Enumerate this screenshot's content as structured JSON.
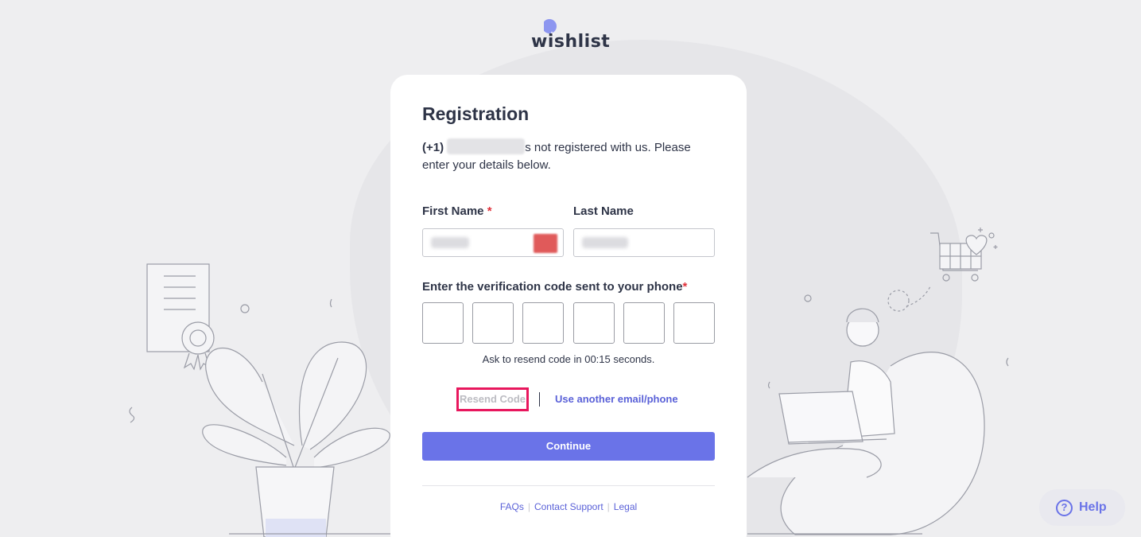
{
  "brand": {
    "name": "wishlist",
    "accent_color": "#6a73e8",
    "logo_icon": "balloon-star-icon"
  },
  "registration": {
    "title": "Registration",
    "country_code": "(+1)",
    "message": "s not registered with us. Please enter your details below.",
    "first_name_label": "First Name",
    "first_name_required": "*",
    "last_name_label": "Last Name",
    "verification_label": "Enter the verification code sent to your phone",
    "verification_required": "*",
    "code_digits": [
      "",
      "",
      "",
      "",
      "",
      ""
    ],
    "timer_text": "Ask to resend code in 00:15 seconds.",
    "resend_label": "Resend Code",
    "alt_link_label": "Use another email/phone",
    "continue_label": "Continue"
  },
  "footer": {
    "links": [
      "FAQs",
      "Contact Support",
      "Legal"
    ]
  },
  "help": {
    "label": "Help",
    "icon": "question-circle-icon"
  }
}
